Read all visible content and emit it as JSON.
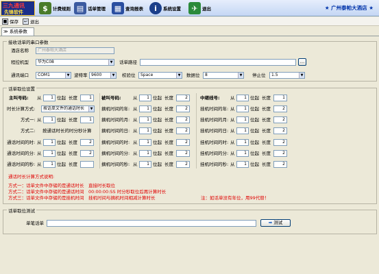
{
  "logo": {
    "line1": "三九通讯",
    "line2": "先锋软件"
  },
  "toolbar": {
    "items": [
      {
        "label": "计费规则",
        "icon": "coins-icon",
        "color": "#4a7b2a"
      },
      {
        "label": "话单管理",
        "icon": "folder-icon",
        "color": "#3b5aa0"
      },
      {
        "label": "查询报表",
        "icon": "report-icon",
        "color": "#2a4ea0"
      },
      {
        "label": "系统设置",
        "icon": "info-icon",
        "color": "#1b3f8a"
      },
      {
        "label": "退出",
        "icon": "run-icon",
        "color": "#2a8a3a"
      }
    ],
    "hotel": "★ 广州泰帕大酒店 ★"
  },
  "subbar": {
    "save": "保存",
    "exit": "退出"
  },
  "tab": "≫ 系统参数",
  "serial": {
    "title": "接收话单的串口参数",
    "hotel_label": "酒店名称",
    "hotel_value": "广州泰帕大酒店",
    "model_label": "程控机型",
    "model_value": "华为C08",
    "path_label": "话单路径",
    "path_value": "",
    "port_label": "通讯端口",
    "port_value": "COM1",
    "baud_label": "波特率",
    "baud_value": "9600",
    "parity_label": "校验位",
    "parity_value": "Space",
    "data_label": "数据位",
    "data_value": "8",
    "stop_label": "停止位",
    "stop_value": "1.5"
  },
  "fields": {
    "title": "话单取位设置",
    "from": "从",
    "pos": "位起",
    "len": "长度",
    "caller": {
      "label": "主叫号码:",
      "from": "1",
      "len": "1"
    },
    "called": {
      "label": "被叫号码:",
      "from": "1",
      "len": "2"
    },
    "relay": {
      "label": "中继线号:",
      "from": "1",
      "len": "1"
    },
    "calc": {
      "label": "时长计算方式:",
      "value": "按话单文件的通话时长"
    },
    "m1": {
      "label": "方式一:",
      "from": "1",
      "len": "1"
    },
    "m2": {
      "label": "方式二:",
      "value": "按通话时长的时分秒计算"
    },
    "left": [
      {
        "label": "通话时间的时:",
        "from": "1",
        "len": "2"
      },
      {
        "label": "通话时间的分:",
        "from": "1",
        "len": "2"
      },
      {
        "label": "通话时间的秒:",
        "from": "1",
        "len": ""
      }
    ],
    "mid": [
      {
        "label": "摘机时间的年:",
        "from": "1",
        "len": "2"
      },
      {
        "label": "摘机时间的月:",
        "from": "1",
        "len": "2"
      },
      {
        "label": "摘机时间的日:",
        "from": "1",
        "len": "2"
      },
      {
        "label": "摘机时间的时:",
        "from": "1",
        "len": "2"
      },
      {
        "label": "摘机时间的分:",
        "from": "1",
        "len": "2"
      },
      {
        "label": "摘机时间的秒:",
        "from": "1",
        "len": "2"
      }
    ],
    "right": [
      {
        "label": "挂机时间的年:",
        "from": "1",
        "len": "2"
      },
      {
        "label": "挂机时间的月:",
        "from": "1",
        "len": "2"
      },
      {
        "label": "挂机时间的日:",
        "from": "1",
        "len": "2"
      },
      {
        "label": "挂机时间的时:",
        "from": "1",
        "len": "2"
      },
      {
        "label": "挂机时间的分:",
        "from": "1",
        "len": "2"
      },
      {
        "label": "挂机时间的秒:",
        "from": "1",
        "len": "2"
      }
    ],
    "notes_title": "通话时长计算方式说明:",
    "notes": [
      "方式一：话单文件中存储的是通话时长　直接时长取位",
      "方式二：话单文件中存储的是通话时间　00:00:00:SS 时分秒取位后再计算时长",
      "方式三：话单文件中存储的是挂机时间　挂机时间与摘机时间相减计算时长"
    ],
    "note_extra": "注：如话单没有年位，用99代替！"
  },
  "test": {
    "title": "话单取位测试",
    "label": "单笔话单",
    "value": "",
    "button": "测试"
  }
}
